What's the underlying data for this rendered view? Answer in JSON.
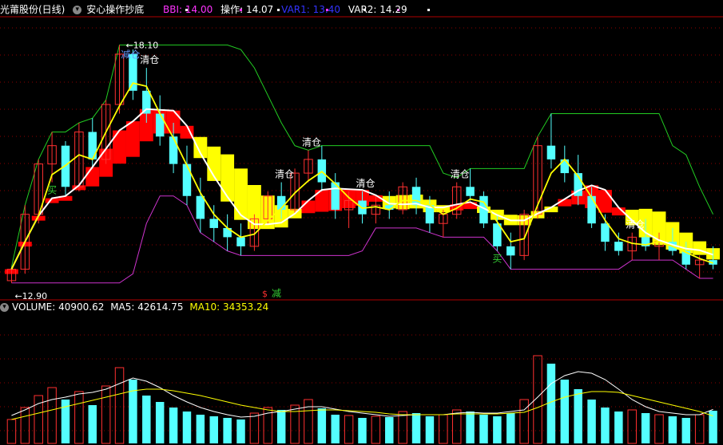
{
  "header": {
    "stock_title": "光莆股份(日线)",
    "indicator_name": "安心操作抄底",
    "bbi_label": "BBI: 14.00",
    "op_label": "操作: 14.07",
    "var1_label": "VAR1: 13.40",
    "var2_label": "VAR2: 14.29",
    "colors": {
      "title": "#ffffff",
      "bbi": "#ff33ff",
      "op": "#ffffff",
      "var1": "#3333ff",
      "var2": "#ffffff"
    }
  },
  "volume_header": {
    "volume_label": "VOLUME: 40900.62",
    "ma5_label": "MA5: 42614.75",
    "ma10_label": "MA10: 34353.24",
    "colors": {
      "volume": "#ffffff",
      "ma5": "#ffffff",
      "ma10": "#ffff00"
    }
  },
  "annotations": {
    "max_price": "18.10",
    "min_price": "12.90",
    "reduce_top": "减仓",
    "signal_buy": "买",
    "signal_clear": "清仓",
    "signal_reduce": "减",
    "signal_dollar": "$"
  },
  "chart_data": {
    "type": "candlestick",
    "price_range": [
      12.6,
      18.7
    ],
    "candles": [
      [
        12.95,
        13.25,
        12.9,
        13.2
      ],
      [
        13.2,
        14.6,
        13.1,
        14.4
      ],
      [
        14.4,
        15.6,
        14.2,
        15.5
      ],
      [
        15.5,
        16.2,
        15.1,
        15.9
      ],
      [
        15.9,
        16.0,
        14.8,
        15.0
      ],
      [
        15.0,
        16.4,
        14.9,
        16.2
      ],
      [
        16.2,
        16.5,
        15.4,
        15.6
      ],
      [
        15.6,
        16.9,
        15.5,
        16.8
      ],
      [
        16.8,
        18.1,
        16.6,
        17.9
      ],
      [
        17.9,
        18.0,
        16.9,
        17.1
      ],
      [
        17.1,
        17.6,
        16.4,
        16.6
      ],
      [
        16.6,
        17.0,
        15.9,
        16.1
      ],
      [
        16.1,
        16.4,
        15.3,
        15.5
      ],
      [
        15.5,
        15.9,
        14.6,
        14.8
      ],
      [
        14.8,
        15.2,
        14.0,
        14.3
      ],
      [
        14.3,
        14.6,
        13.8,
        14.1
      ],
      [
        14.1,
        14.4,
        13.6,
        13.9
      ],
      [
        13.9,
        14.2,
        13.5,
        13.7
      ],
      [
        13.7,
        14.4,
        13.6,
        14.3
      ],
      [
        14.3,
        14.9,
        14.2,
        14.8
      ],
      [
        14.8,
        15.1,
        14.3,
        14.5
      ],
      [
        14.5,
        15.4,
        14.4,
        15.3
      ],
      [
        15.3,
        15.8,
        15.1,
        15.6
      ],
      [
        15.6,
        15.9,
        14.9,
        15.1
      ],
      [
        15.1,
        15.3,
        14.3,
        14.5
      ],
      [
        14.5,
        14.9,
        14.1,
        14.7
      ],
      [
        14.7,
        14.9,
        14.2,
        14.4
      ],
      [
        14.4,
        14.8,
        14.2,
        14.6
      ],
      [
        14.6,
        14.9,
        14.3,
        14.5
      ],
      [
        14.5,
        15.1,
        14.4,
        15.0
      ],
      [
        15.0,
        15.2,
        14.4,
        14.6
      ],
      [
        14.6,
        14.8,
        14.0,
        14.2
      ],
      [
        14.2,
        14.5,
        13.9,
        14.4
      ],
      [
        14.4,
        15.1,
        14.3,
        15.0
      ],
      [
        15.0,
        15.4,
        14.7,
        14.8
      ],
      [
        14.8,
        14.9,
        14.1,
        14.2
      ],
      [
        14.2,
        14.4,
        13.6,
        13.7
      ],
      [
        13.7,
        14.0,
        13.2,
        13.5
      ],
      [
        13.5,
        14.5,
        13.4,
        14.4
      ],
      [
        14.4,
        16.1,
        14.3,
        15.9
      ],
      [
        15.9,
        16.6,
        15.4,
        15.6
      ],
      [
        15.6,
        15.9,
        15.1,
        15.3
      ],
      [
        15.3,
        15.7,
        14.6,
        14.8
      ],
      [
        14.8,
        15.0,
        14.1,
        14.2
      ],
      [
        14.2,
        14.4,
        13.6,
        13.8
      ],
      [
        13.8,
        14.0,
        13.5,
        13.6
      ],
      [
        13.6,
        14.0,
        13.4,
        13.9
      ],
      [
        13.9,
        14.3,
        13.6,
        13.7
      ],
      [
        13.7,
        14.0,
        13.4,
        13.8
      ],
      [
        13.8,
        14.1,
        13.5,
        13.6
      ],
      [
        13.6,
        13.8,
        13.2,
        13.3
      ],
      [
        13.3,
        13.5,
        13.0,
        13.4
      ],
      [
        13.4,
        13.7,
        13.2,
        13.3
      ]
    ],
    "volume_range": [
      0,
      160000
    ],
    "volume": [
      30,
      45,
      60,
      70,
      55,
      65,
      48,
      72,
      95,
      80,
      60,
      52,
      45,
      40,
      36,
      34,
      32,
      30,
      38,
      45,
      42,
      48,
      55,
      44,
      36,
      35,
      32,
      34,
      33,
      40,
      38,
      34,
      36,
      42,
      40,
      36,
      34,
      38,
      55,
      110,
      100,
      80,
      68,
      55,
      45,
      40,
      42,
      38,
      36,
      34,
      32,
      36,
      40.9
    ],
    "ma5": [
      35,
      42,
      50,
      55,
      58,
      62,
      64,
      68,
      75,
      82,
      78,
      70,
      60,
      52,
      45,
      40,
      36,
      33,
      34,
      38,
      40,
      43,
      46,
      46,
      43,
      40,
      38,
      36,
      34,
      35,
      36,
      36,
      36,
      38,
      39,
      38,
      38,
      40,
      42,
      58,
      75,
      85,
      90,
      88,
      80,
      68,
      55,
      46,
      40,
      38,
      36,
      36,
      42.6
    ],
    "ma10": [
      30,
      34,
      38,
      42,
      46,
      50,
      54,
      58,
      62,
      66,
      68,
      68,
      66,
      63,
      60,
      56,
      52,
      48,
      45,
      42,
      40,
      40,
      41,
      42,
      42,
      41,
      40,
      39,
      37,
      36,
      36,
      36,
      36,
      37,
      37,
      37,
      37,
      38,
      39,
      45,
      52,
      58,
      62,
      65,
      65,
      64,
      60,
      56,
      52,
      48,
      44,
      40,
      34.4
    ]
  }
}
